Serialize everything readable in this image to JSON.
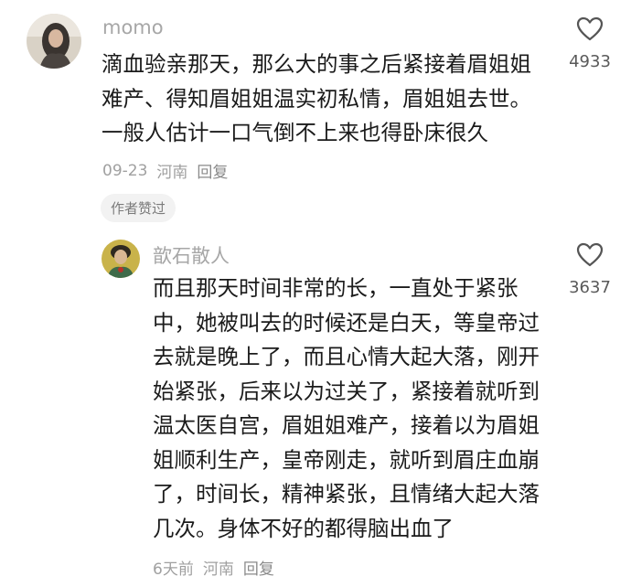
{
  "comments": [
    {
      "username": "momo",
      "lines": [
        "滴血验亲那天，那么大的事之后紧接着眉姐姐",
        "难产、得知眉姐姐温实初私情，眉姐姐去世。",
        "一般人估计一口气倒不上来也得卧床很久"
      ],
      "date": "09-23",
      "location": "河南",
      "reply_label": "回复",
      "badge": "作者赞过",
      "likes": "4933"
    },
    {
      "username": "歆石散人",
      "lines": [
        "而且那天时间非常的长，一直处于紧张",
        "中，她被叫去的时候还是白天，等皇帝过",
        "去就是晚上了，而且心情大起大落，刚开",
        "始紧张，后来以为过关了，紧接着就听到",
        "温太医自宫，眉姐姐难产，接着以为眉姐",
        "姐顺利生产，皇帝刚走，就听到眉庄血崩",
        "了，时间长，精神紧张，且情绪大起大落",
        "几次。身体不好的都得脑出血了"
      ],
      "date": "6天前",
      "location": "河南",
      "reply_label": "回复",
      "likes": "3637"
    }
  ]
}
